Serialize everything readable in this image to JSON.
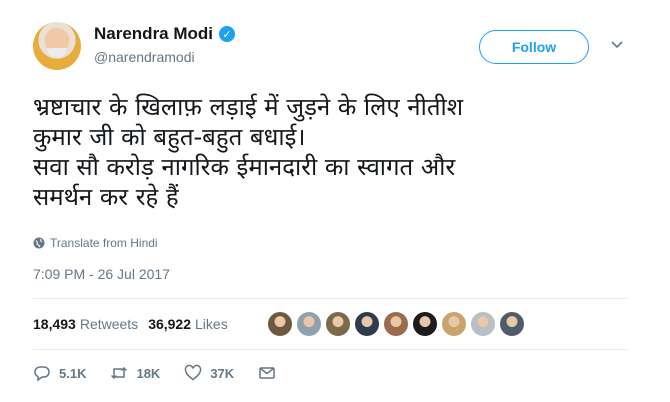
{
  "author": {
    "name": "Narendra Modi",
    "handle": "@narendramodi",
    "verified_glyph": "✓"
  },
  "follow_label": "Follow",
  "tweet": {
    "text": "भ्रष्टाचार के खिलाफ़ लड़ाई में जुड़ने के लिए नीतीश\nकुमार जी को बहुत-बहुत बधाई।\nसवा सौ करोड़ नागरिक ईमानदारी का स्वागत और\nसमर्थन कर रहे हैं",
    "translate_label": "Translate from Hindi",
    "timestamp": "7:09 PM - 26 Jul 2017"
  },
  "stats": {
    "retweets_count": "18,493",
    "retweets_label": "Retweets",
    "likes_count": "36,922",
    "likes_label": "Likes"
  },
  "liker_avatars": [
    "#6b5a3e",
    "#8fa1ad",
    "#7a6a4a",
    "#2e3b50",
    "#9a6b4f",
    "#1c1c1c",
    "#c9a46e",
    "#b7c0c6",
    "#4f5d6b"
  ],
  "actions": {
    "replies": "5.1K",
    "retweets": "18K",
    "likes": "37K"
  },
  "colors": {
    "accent": "#1da1f2",
    "secondary_text": "#657786",
    "divider": "#e6ecf0"
  }
}
